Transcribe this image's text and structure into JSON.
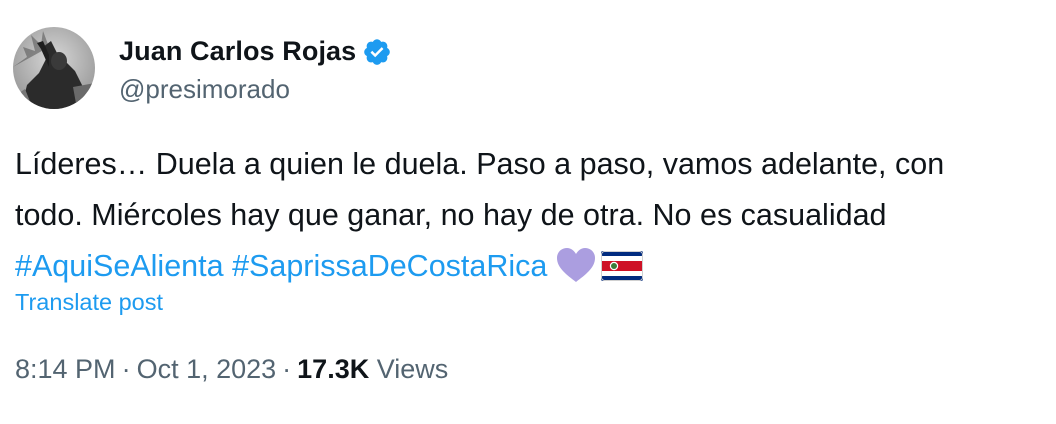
{
  "author": {
    "display_name": "Juan Carlos Rojas",
    "handle": "@presimorado",
    "verified": true,
    "verified_color": "#1d9bf0"
  },
  "tweet": {
    "line1": "Líderes… Duela a quien le duela. Paso a paso, vamos adelante, con",
    "line2": "todo. Miércoles hay que ganar, no hay de otra. No es casualidad",
    "hashtags": [
      "#AquiSeAlienta",
      "#SaprissaDeCostaRica"
    ],
    "emojis": [
      "purple-heart-icon",
      "costa-rica-flag-icon"
    ]
  },
  "translate_label": "Translate post",
  "meta": {
    "time": "8:14 PM",
    "separator": "·",
    "date": "Oct 1, 2023",
    "views_count": "17.3K",
    "views_label": "Views"
  },
  "colors": {
    "text": "#0f1419",
    "secondary": "#536471",
    "link": "#1d9bf0",
    "heart": "#ab9ee0"
  }
}
